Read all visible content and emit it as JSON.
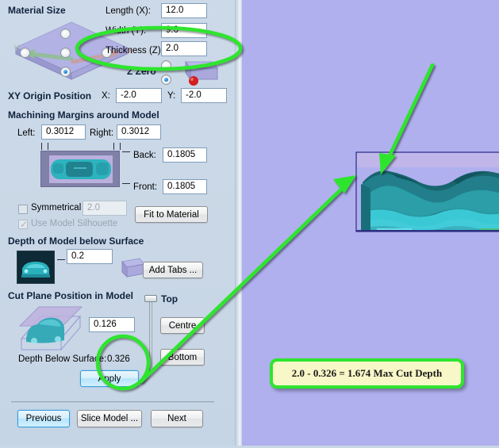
{
  "material": {
    "heading": "Material Size",
    "fields": [
      {
        "label": "Length (X):",
        "value": "12.0"
      },
      {
        "label": "Width (Y):",
        "value": "9.0"
      },
      {
        "label": "Thickness (Z):",
        "value": "2.0"
      }
    ],
    "zzero_label": "Z Zero",
    "origin_heading": "XY Origin Position",
    "origin_x_label": "X:",
    "origin_x_value": "-2.0",
    "origin_y_label": "Y:",
    "origin_y_value": "-2.0"
  },
  "margins": {
    "heading": "Machining Margins around Model",
    "left_label": "Left:",
    "left_value": "0.3012",
    "right_label": "Right:",
    "right_value": "0.3012",
    "back_label": "Back:",
    "back_value": "0.1805",
    "front_label": "Front:",
    "front_value": "0.1805",
    "symmetrical_label": "Symmetrical",
    "symmetrical_value": "2.0",
    "silhouette_label": "Use Model Silhouette",
    "fit_button": "Fit to Material"
  },
  "depth": {
    "heading": "Depth of Model below Surface",
    "value": "0.2",
    "add_tabs_button": "Add Tabs ..."
  },
  "cutplane": {
    "heading": "Cut Plane Position in Model",
    "value": "0.126",
    "depth_below_label": "Depth Below Surface:",
    "depth_below_value": "0.326",
    "apply_button": "Apply",
    "top_label": "Top",
    "centre_button": "Centre",
    "bottom_button": "Bottom"
  },
  "footer": {
    "previous_button": "Previous",
    "slice_button": "Slice Model ...",
    "next_button": "Next"
  },
  "annotation": {
    "callout_text": "2.0 - 0.326 = 1.674 Max Cut Depth",
    "highlight_color": "#2ee52e",
    "callout_bg": "#f7f7c8"
  },
  "colors": {
    "panel_bg": "#ccd9e8",
    "viewport_bg": "#b0b0ef",
    "model_teal": "#2aa8b4",
    "material_violet": "#9d9ddd"
  }
}
